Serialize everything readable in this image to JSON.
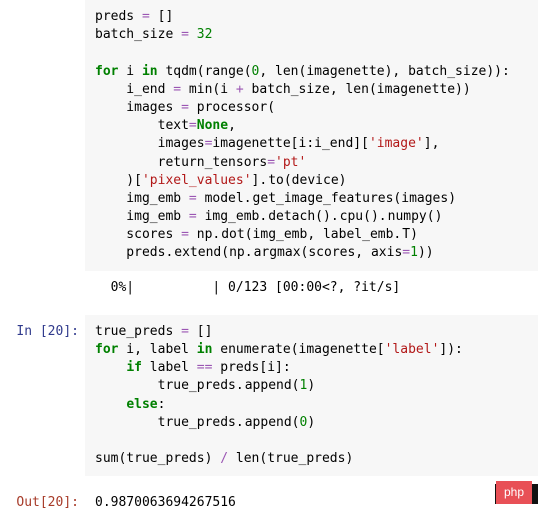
{
  "cell1": {
    "code": [
      {
        "segs": [
          {
            "t": "preds ",
            "c": ""
          },
          {
            "t": "=",
            "c": "op"
          },
          {
            "t": " []",
            "c": ""
          }
        ]
      },
      {
        "segs": [
          {
            "t": "batch_size ",
            "c": ""
          },
          {
            "t": "=",
            "c": "op"
          },
          {
            "t": " ",
            "c": ""
          },
          {
            "t": "32",
            "c": "num"
          }
        ]
      },
      {
        "segs": []
      },
      {
        "segs": [
          {
            "t": "for",
            "c": "kw"
          },
          {
            "t": " i ",
            "c": ""
          },
          {
            "t": "in",
            "c": "kw"
          },
          {
            "t": " tqdm(range(",
            "c": ""
          },
          {
            "t": "0",
            "c": "num"
          },
          {
            "t": ", len(imagenette), batch_size)):",
            "c": ""
          }
        ]
      },
      {
        "segs": [
          {
            "t": "    i_end ",
            "c": ""
          },
          {
            "t": "=",
            "c": "op"
          },
          {
            "t": " min(i ",
            "c": ""
          },
          {
            "t": "+",
            "c": "op"
          },
          {
            "t": " batch_size, len(imagenette))",
            "c": ""
          }
        ]
      },
      {
        "segs": [
          {
            "t": "    images ",
            "c": ""
          },
          {
            "t": "=",
            "c": "op"
          },
          {
            "t": " processor(",
            "c": ""
          }
        ]
      },
      {
        "segs": [
          {
            "t": "        text",
            "c": ""
          },
          {
            "t": "=",
            "c": "op"
          },
          {
            "t": "None",
            "c": "name-bold"
          },
          {
            "t": ",",
            "c": ""
          }
        ]
      },
      {
        "segs": [
          {
            "t": "        images",
            "c": ""
          },
          {
            "t": "=",
            "c": "op"
          },
          {
            "t": "imagenette[i:i_end][",
            "c": ""
          },
          {
            "t": "'image'",
            "c": "str"
          },
          {
            "t": "],",
            "c": ""
          }
        ]
      },
      {
        "segs": [
          {
            "t": "        return_tensors",
            "c": ""
          },
          {
            "t": "=",
            "c": "op"
          },
          {
            "t": "'pt'",
            "c": "str"
          }
        ]
      },
      {
        "segs": [
          {
            "t": "    )[",
            "c": ""
          },
          {
            "t": "'pixel_values'",
            "c": "str"
          },
          {
            "t": "].to(device)",
            "c": ""
          }
        ]
      },
      {
        "segs": [
          {
            "t": "    img_emb ",
            "c": ""
          },
          {
            "t": "=",
            "c": "op"
          },
          {
            "t": " model.get_image_features(images)",
            "c": ""
          }
        ]
      },
      {
        "segs": [
          {
            "t": "    img_emb ",
            "c": ""
          },
          {
            "t": "=",
            "c": "op"
          },
          {
            "t": " img_emb.detach().cpu().numpy()",
            "c": ""
          }
        ]
      },
      {
        "segs": [
          {
            "t": "    scores ",
            "c": ""
          },
          {
            "t": "=",
            "c": "op"
          },
          {
            "t": " np.dot(img_emb, label_emb.T)",
            "c": ""
          }
        ]
      },
      {
        "segs": [
          {
            "t": "    preds.extend(np.argmax(scores, axis",
            "c": ""
          },
          {
            "t": "=",
            "c": "op"
          },
          {
            "t": "1",
            "c": "num"
          },
          {
            "t": "))",
            "c": ""
          }
        ]
      }
    ],
    "output": "  0%|          | 0/123 [00:00<?, ?it/s]"
  },
  "cell2": {
    "prompt_in": "In [20]:",
    "prompt_out": "Out[20]:",
    "code": [
      {
        "segs": [
          {
            "t": "true_preds ",
            "c": ""
          },
          {
            "t": "=",
            "c": "op"
          },
          {
            "t": " []",
            "c": ""
          }
        ]
      },
      {
        "segs": [
          {
            "t": "for",
            "c": "kw"
          },
          {
            "t": " i, label ",
            "c": ""
          },
          {
            "t": "in",
            "c": "kw"
          },
          {
            "t": " enumerate(imagenette[",
            "c": ""
          },
          {
            "t": "'label'",
            "c": "str"
          },
          {
            "t": "]):",
            "c": ""
          }
        ]
      },
      {
        "segs": [
          {
            "t": "    ",
            "c": ""
          },
          {
            "t": "if",
            "c": "kw"
          },
          {
            "t": " label ",
            "c": ""
          },
          {
            "t": "==",
            "c": "op"
          },
          {
            "t": " preds[i]:",
            "c": ""
          }
        ]
      },
      {
        "segs": [
          {
            "t": "        true_preds.append(",
            "c": ""
          },
          {
            "t": "1",
            "c": "num"
          },
          {
            "t": ")",
            "c": ""
          }
        ]
      },
      {
        "segs": [
          {
            "t": "    ",
            "c": ""
          },
          {
            "t": "else",
            "c": "kw"
          },
          {
            "t": ":",
            "c": ""
          }
        ]
      },
      {
        "segs": [
          {
            "t": "        true_preds.append(",
            "c": ""
          },
          {
            "t": "0",
            "c": "num"
          },
          {
            "t": ")",
            "c": ""
          }
        ]
      },
      {
        "segs": []
      },
      {
        "segs": [
          {
            "t": "sum(true_preds) ",
            "c": ""
          },
          {
            "t": "/",
            "c": "op"
          },
          {
            "t": " len(true_preds)",
            "c": ""
          }
        ]
      }
    ],
    "output": "0.9870063694267516"
  },
  "brand": "php"
}
